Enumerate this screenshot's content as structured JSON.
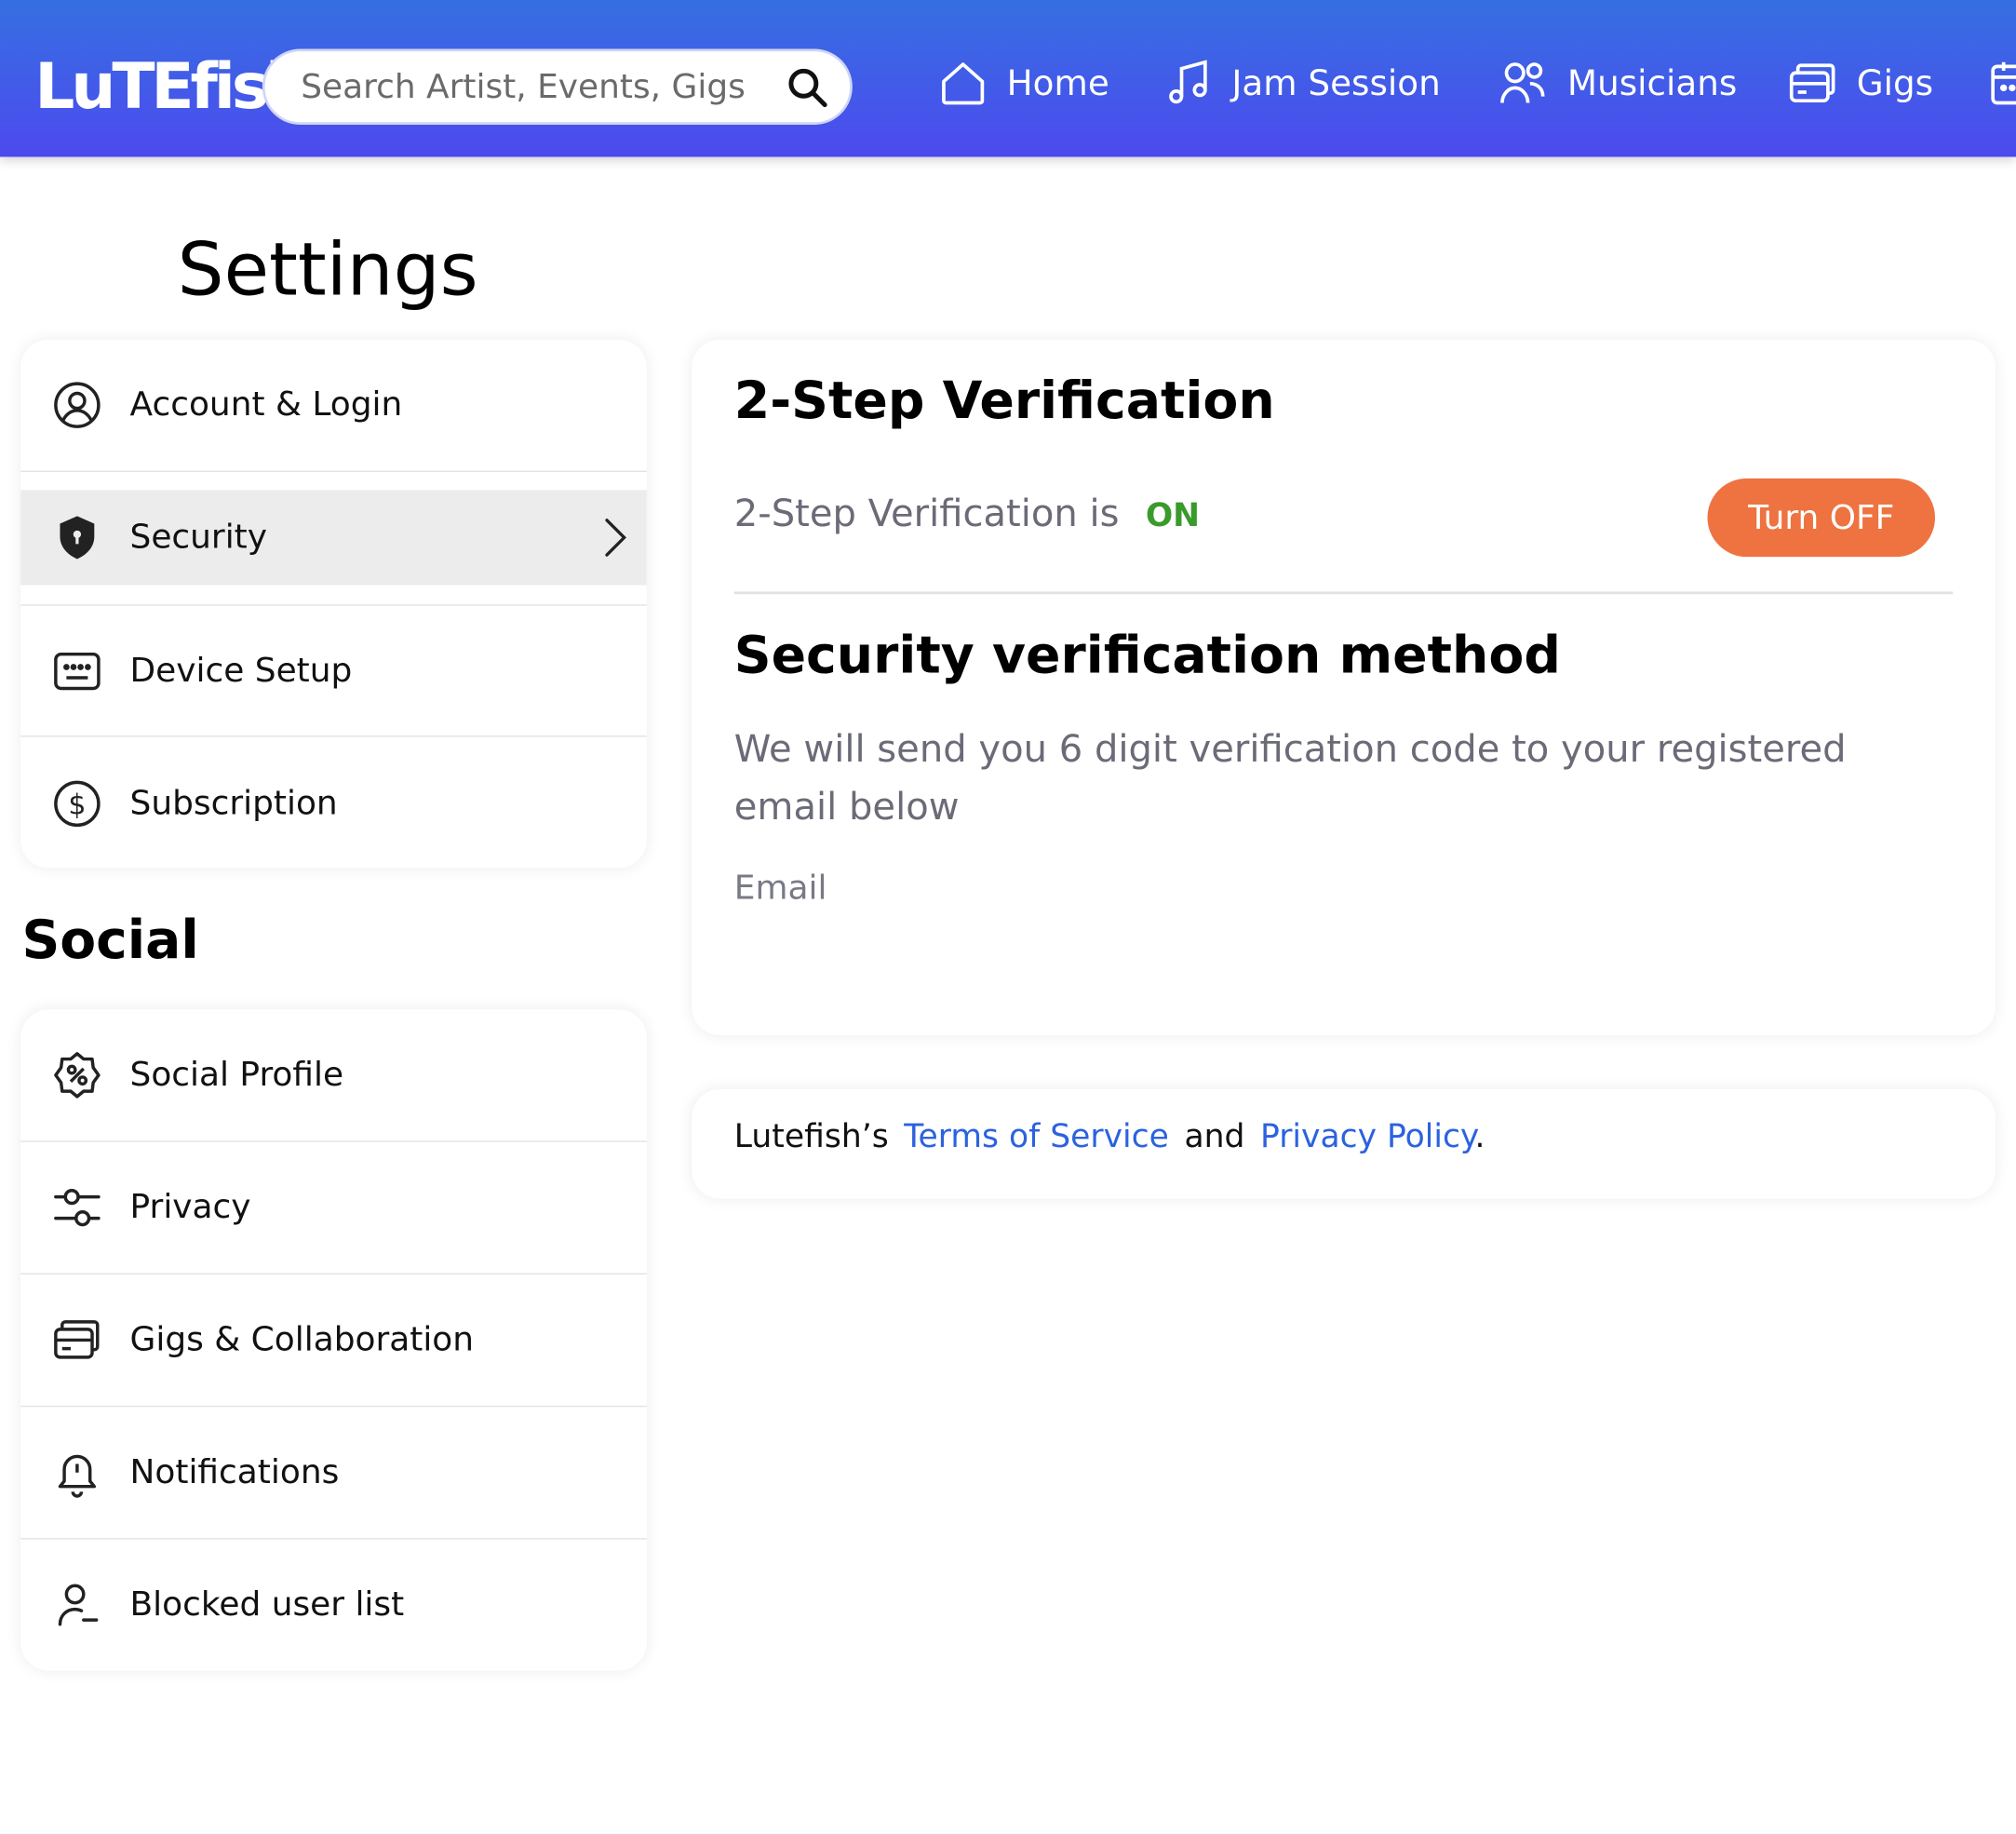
{
  "brand": {
    "logo_text": "LuTEfish"
  },
  "search": {
    "placeholder": "Search Artist, Events, Gigs"
  },
  "nav": {
    "items": [
      {
        "label": "Home",
        "icon": "home-icon"
      },
      {
        "label": "Jam Session",
        "icon": "music-note-icon"
      },
      {
        "label": "Musicians",
        "icon": "users-icon"
      },
      {
        "label": "Gigs",
        "icon": "cards-icon"
      }
    ],
    "overflow_icon": "calendar-icon"
  },
  "page": {
    "title": "Settings"
  },
  "sidebar": {
    "account_items": [
      {
        "label": "Account & Login",
        "icon": "user-circle-icon"
      },
      {
        "label": "Security",
        "icon": "shield-icon",
        "active": true
      },
      {
        "label": "Device Setup",
        "icon": "keyboard-icon"
      },
      {
        "label": "Subscription",
        "icon": "dollar-circle-icon"
      }
    ],
    "social_title": "Social",
    "social_items": [
      {
        "label": "Social Profile",
        "icon": "badge-percent-icon"
      },
      {
        "label": "Privacy",
        "icon": "sliders-icon"
      },
      {
        "label": "Gigs & Collaboration",
        "icon": "cards-icon"
      },
      {
        "label": "Notifications",
        "icon": "bell-icon"
      },
      {
        "label": "Blocked user list",
        "icon": "user-minus-icon"
      }
    ]
  },
  "main": {
    "two_step_title": "2-Step Verification",
    "status_text": "2-Step Verification is",
    "status_value": "ON",
    "toggle_button": "Turn OFF",
    "method_title": "Security verification method",
    "method_description": "We will send you 6 digit verification code to your registered email below",
    "email_label": "Email"
  },
  "footer": {
    "prefix": "Lutefish’s",
    "terms_link": "Terms of Service",
    "conjunction": "and",
    "privacy_link": "Privacy Policy",
    "suffix": "."
  },
  "colors": {
    "header_top": "#356fe2",
    "header_bottom": "#4d4aee",
    "accent_orange": "#ee7340",
    "status_green": "#3a9a2c",
    "link_blue": "#2b62e0",
    "active_row": "#ececec"
  }
}
